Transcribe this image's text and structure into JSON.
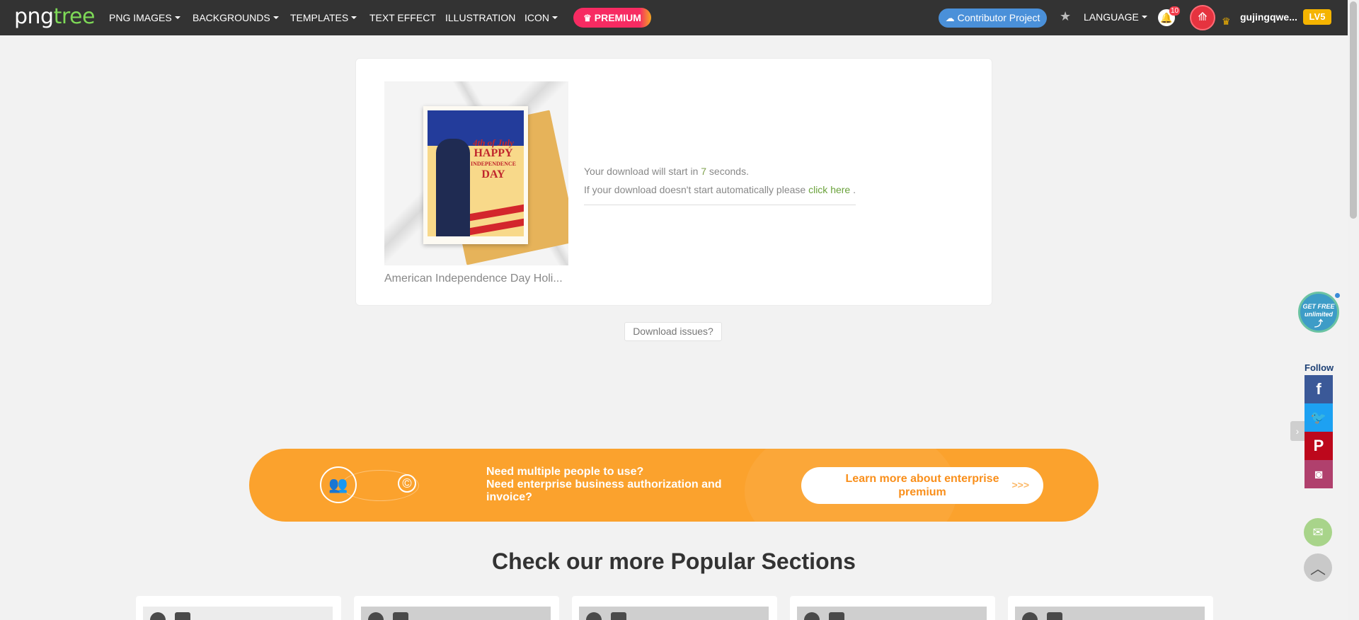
{
  "nav": {
    "logo_png": "png",
    "logo_tree": "tree",
    "items": [
      {
        "label": "PNG IMAGES",
        "dropdown": true
      },
      {
        "label": "BACKGROUNDS",
        "dropdown": true
      },
      {
        "label": "TEMPLATES",
        "dropdown": true
      },
      {
        "label": "TEXT EFFECT",
        "dropdown": false
      },
      {
        "label": "ILLUSTRATION",
        "dropdown": false
      },
      {
        "label": "ICON",
        "dropdown": true
      }
    ],
    "premium_label": "PREMIUM",
    "contributor_label": "Contributor Project",
    "language_label": "LANGUAGE",
    "notification_count": "10",
    "username": "gujingqwe...",
    "level": "LV5"
  },
  "download": {
    "thumb_title": "American Independence Day Holi...",
    "poster_line1": "4th of July",
    "poster_line2": "HAPPY",
    "poster_line3": "INDEPENDENCE",
    "poster_line4": "DAY",
    "msg_prefix": "Your download will start in ",
    "seconds": "7",
    "msg_suffix": " seconds.",
    "fallback_prefix": "If your download doesn't start automatically please ",
    "click_here": "click here",
    "fallback_suffix": " .",
    "issues_label": "Download issues?"
  },
  "banner": {
    "line1": "Need multiple people to use?",
    "line2": "Need enterprise business authorization and invoice?",
    "button_label": "Learn more about enterprise premium",
    "button_arrows": ">>>"
  },
  "popular": {
    "title": "Check our more Popular Sections"
  },
  "side": {
    "free_line1": "GET FREE",
    "free_line2": "unlimited",
    "follow_label": "Follow"
  },
  "colors": {
    "nav_bg": "#333333",
    "premium": "#f72b62",
    "contributor": "#4a90d9",
    "banner": "#fba22d",
    "link_green": "#6aa23b"
  }
}
